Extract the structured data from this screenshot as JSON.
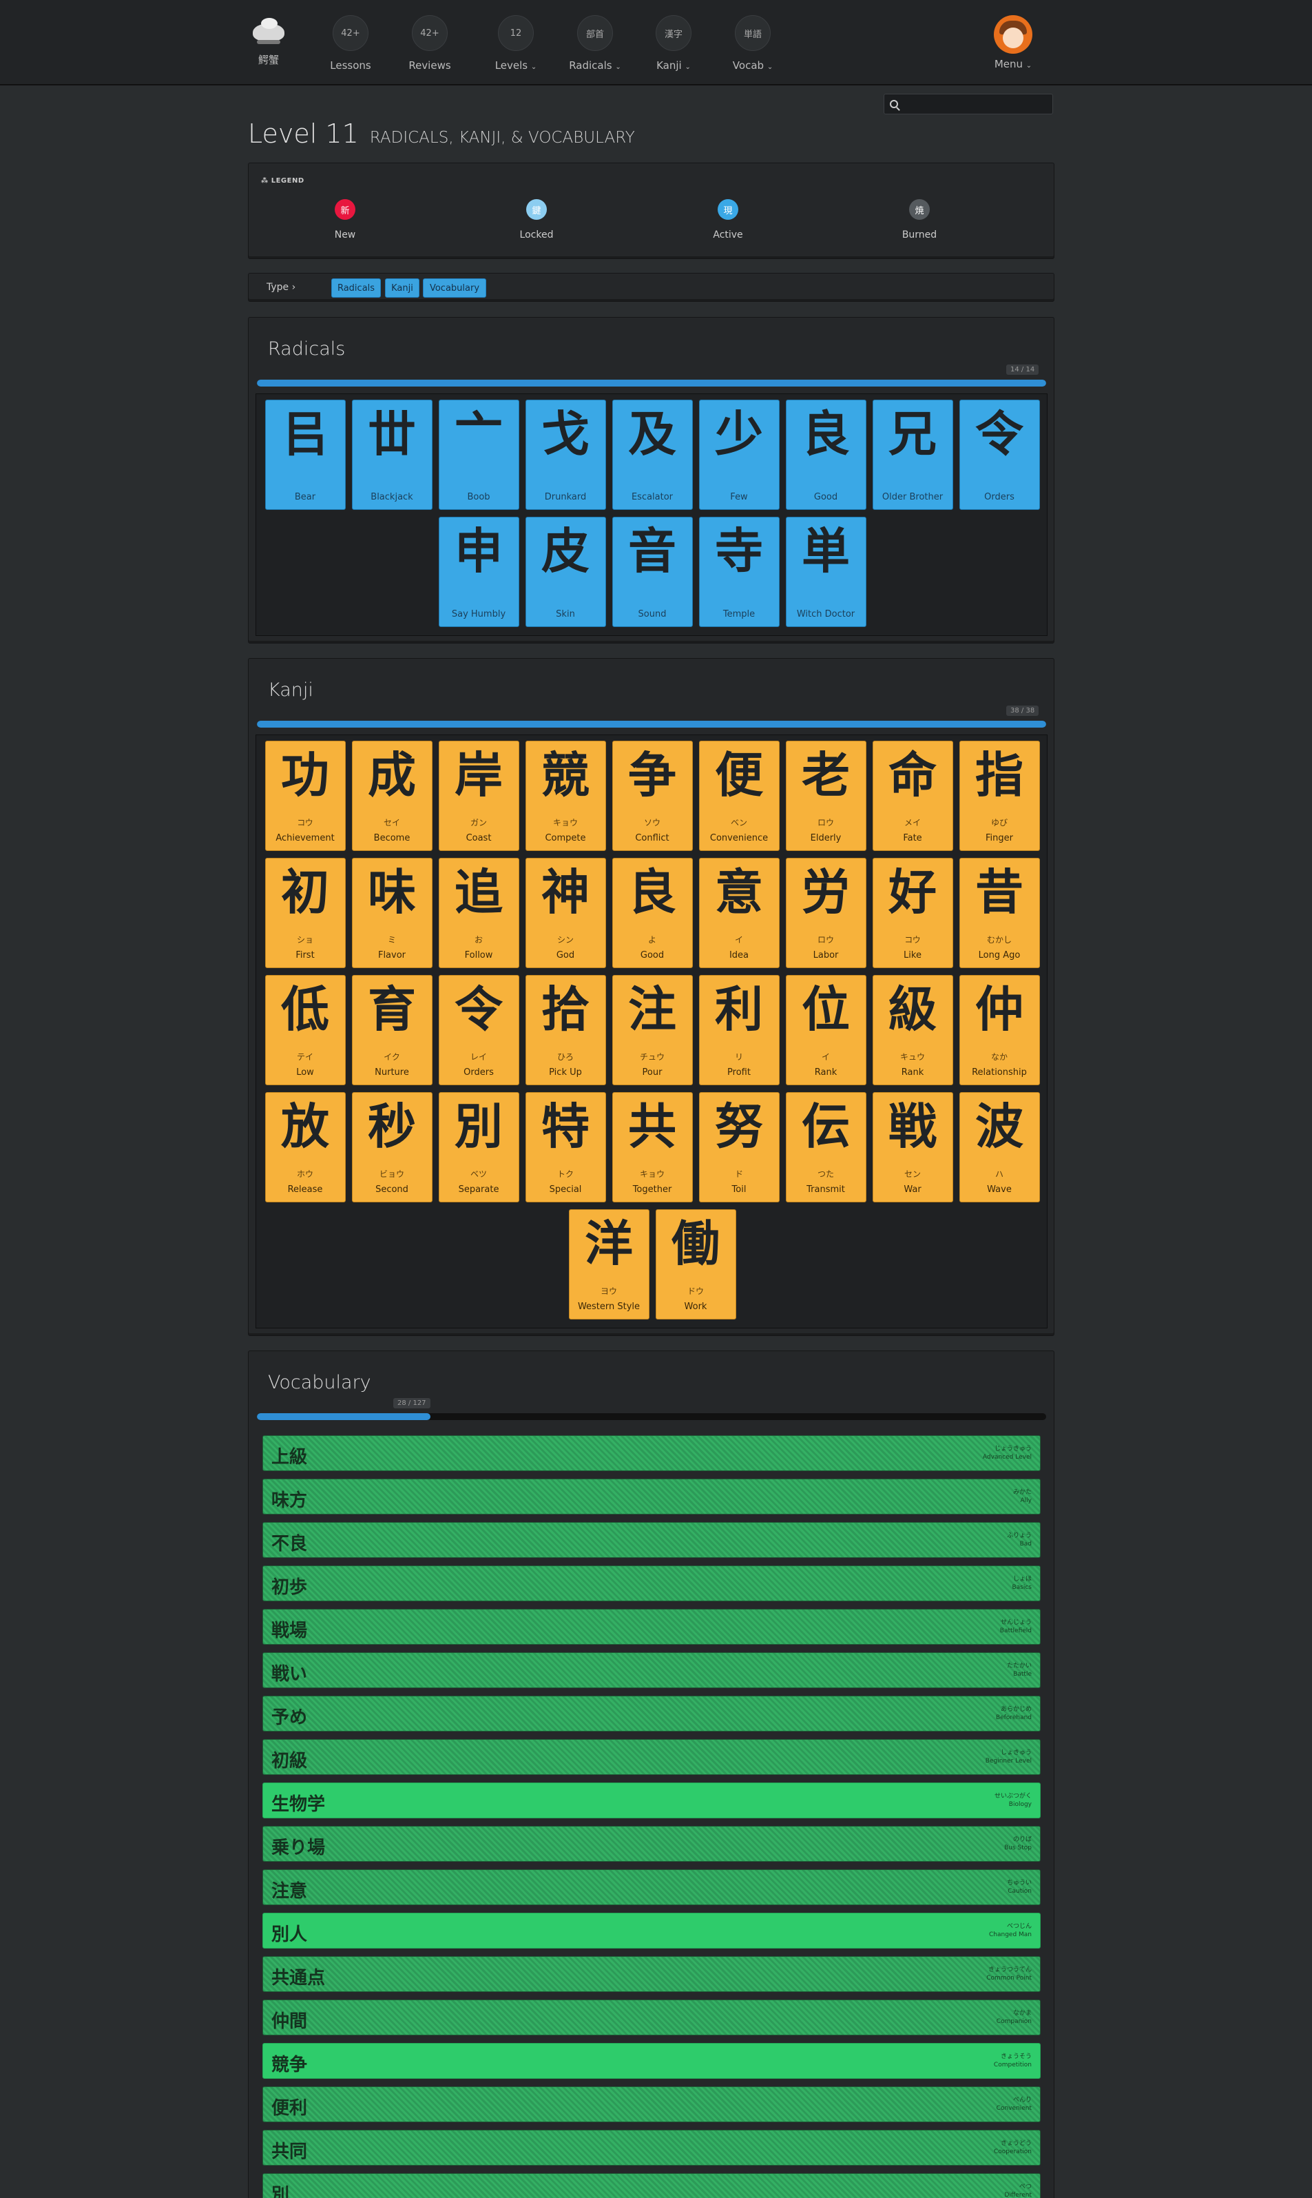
{
  "nav": {
    "logo_label": "鰐蟹",
    "items": [
      {
        "circle": "42+",
        "label": "Lessons"
      },
      {
        "circle": "42+",
        "label": "Reviews"
      },
      {
        "circle": "12",
        "label": "Levels"
      },
      {
        "circle": "部首",
        "label": "Radicals"
      },
      {
        "circle": "漢字",
        "label": "Kanji"
      },
      {
        "circle": "単語",
        "label": "Vocab"
      }
    ],
    "menu_label": "Menu"
  },
  "search": {
    "value": "",
    "placeholder": ""
  },
  "title": {
    "main": "Level 11",
    "sub": "RADICALS, KANJI, & VOCABULARY"
  },
  "legend": {
    "title": "LEGEND",
    "items": [
      {
        "glyph": "新",
        "label": "New",
        "color": "#e8173f"
      },
      {
        "glyph": "鍵",
        "label": "Locked",
        "color": "#8ccdf0"
      },
      {
        "glyph": "現",
        "label": "Active",
        "color": "#3aa8e6"
      },
      {
        "glyph": "焼",
        "label": "Burned",
        "color": "#555a5e"
      }
    ]
  },
  "type_filter": {
    "label": "Type",
    "buttons": [
      "Radicals",
      "Kanji",
      "Vocabulary"
    ]
  },
  "radicals": {
    "title": "Radicals",
    "progress_text": "14 / 14",
    "progress": 1.0,
    "items": [
      {
        "char": "㠯",
        "meaning": "Bear"
      },
      {
        "char": "丗",
        "meaning": "Blackjack"
      },
      {
        "char": "亠",
        "meaning": "Boob"
      },
      {
        "char": "戈",
        "meaning": "Drunkard"
      },
      {
        "char": "及",
        "meaning": "Escalator"
      },
      {
        "char": "少",
        "meaning": "Few"
      },
      {
        "char": "良",
        "meaning": "Good"
      },
      {
        "char": "兄",
        "meaning": "Older Brother"
      },
      {
        "char": "令",
        "meaning": "Orders"
      },
      {
        "char": "申",
        "meaning": "Say Humbly"
      },
      {
        "char": "皮",
        "meaning": "Skin"
      },
      {
        "char": "音",
        "meaning": "Sound"
      },
      {
        "char": "寺",
        "meaning": "Temple"
      },
      {
        "char": "単",
        "meaning": "Witch Doctor"
      }
    ]
  },
  "kanji": {
    "title": "Kanji",
    "progress_text": "38 / 38",
    "progress": 1.0,
    "items": [
      {
        "char": "功",
        "reading": "コウ",
        "meaning": "Achievement"
      },
      {
        "char": "成",
        "reading": "セイ",
        "meaning": "Become"
      },
      {
        "char": "岸",
        "reading": "ガン",
        "meaning": "Coast"
      },
      {
        "char": "競",
        "reading": "キョウ",
        "meaning": "Compete"
      },
      {
        "char": "争",
        "reading": "ソウ",
        "meaning": "Conflict"
      },
      {
        "char": "便",
        "reading": "ベン",
        "meaning": "Convenience"
      },
      {
        "char": "老",
        "reading": "ロウ",
        "meaning": "Elderly"
      },
      {
        "char": "命",
        "reading": "メイ",
        "meaning": "Fate"
      },
      {
        "char": "指",
        "reading": "ゆび",
        "meaning": "Finger"
      },
      {
        "char": "初",
        "reading": "ショ",
        "meaning": "First"
      },
      {
        "char": "味",
        "reading": "ミ",
        "meaning": "Flavor"
      },
      {
        "char": "追",
        "reading": "お",
        "meaning": "Follow"
      },
      {
        "char": "神",
        "reading": "シン",
        "meaning": "God"
      },
      {
        "char": "良",
        "reading": "よ",
        "meaning": "Good"
      },
      {
        "char": "意",
        "reading": "イ",
        "meaning": "Idea"
      },
      {
        "char": "労",
        "reading": "ロウ",
        "meaning": "Labor"
      },
      {
        "char": "好",
        "reading": "コウ",
        "meaning": "Like"
      },
      {
        "char": "昔",
        "reading": "むかし",
        "meaning": "Long Ago"
      },
      {
        "char": "低",
        "reading": "テイ",
        "meaning": "Low"
      },
      {
        "char": "育",
        "reading": "イク",
        "meaning": "Nurture"
      },
      {
        "char": "令",
        "reading": "レイ",
        "meaning": "Orders"
      },
      {
        "char": "拾",
        "reading": "ひろ",
        "meaning": "Pick Up"
      },
      {
        "char": "注",
        "reading": "チュウ",
        "meaning": "Pour"
      },
      {
        "char": "利",
        "reading": "リ",
        "meaning": "Profit"
      },
      {
        "char": "位",
        "reading": "イ",
        "meaning": "Rank"
      },
      {
        "char": "級",
        "reading": "キュウ",
        "meaning": "Rank"
      },
      {
        "char": "仲",
        "reading": "なか",
        "meaning": "Relationship"
      },
      {
        "char": "放",
        "reading": "ホウ",
        "meaning": "Release"
      },
      {
        "char": "秒",
        "reading": "ビョウ",
        "meaning": "Second"
      },
      {
        "char": "別",
        "reading": "ベツ",
        "meaning": "Separate"
      },
      {
        "char": "特",
        "reading": "トク",
        "meaning": "Special"
      },
      {
        "char": "共",
        "reading": "キョウ",
        "meaning": "Together"
      },
      {
        "char": "努",
        "reading": "ド",
        "meaning": "Toil"
      },
      {
        "char": "伝",
        "reading": "つた",
        "meaning": "Transmit"
      },
      {
        "char": "戦",
        "reading": "セン",
        "meaning": "War"
      },
      {
        "char": "波",
        "reading": "ハ",
        "meaning": "Wave"
      },
      {
        "char": "洋",
        "reading": "ヨウ",
        "meaning": "Western Style"
      },
      {
        "char": "働",
        "reading": "ドウ",
        "meaning": "Work"
      }
    ]
  },
  "vocabulary": {
    "title": "Vocabulary",
    "progress_text": "28 / 127",
    "progress": 0.22,
    "items": [
      {
        "char": "上級",
        "reading": "じょうきゅう",
        "meaning": "Advanced Level",
        "bright": false
      },
      {
        "char": "味方",
        "reading": "みかた",
        "meaning": "Ally",
        "bright": false
      },
      {
        "char": "不良",
        "reading": "ふりょう",
        "meaning": "Bad",
        "bright": false
      },
      {
        "char": "初歩",
        "reading": "しょほ",
        "meaning": "Basics",
        "bright": false
      },
      {
        "char": "戦場",
        "reading": "せんじょう",
        "meaning": "Battlefield",
        "bright": false
      },
      {
        "char": "戦い",
        "reading": "たたかい",
        "meaning": "Battle",
        "bright": false
      },
      {
        "char": "予め",
        "reading": "あらかじめ",
        "meaning": "Beforehand",
        "bright": false
      },
      {
        "char": "初級",
        "reading": "しょきゅう",
        "meaning": "Beginner Level",
        "bright": false
      },
      {
        "char": "生物学",
        "reading": "せいぶつがく",
        "meaning": "Biology",
        "bright": true
      },
      {
        "char": "乗り場",
        "reading": "のりば",
        "meaning": "Bus Stop",
        "bright": false
      },
      {
        "char": "注意",
        "reading": "ちゅうい",
        "meaning": "Caution",
        "bright": false
      },
      {
        "char": "別人",
        "reading": "べつじん",
        "meaning": "Changed Man",
        "bright": true
      },
      {
        "char": "共通点",
        "reading": "きょうつうてん",
        "meaning": "Common Point",
        "bright": false
      },
      {
        "char": "仲間",
        "reading": "なかま",
        "meaning": "Companion",
        "bright": false
      },
      {
        "char": "競争",
        "reading": "きょうそう",
        "meaning": "Competition",
        "bright": true
      },
      {
        "char": "便利",
        "reading": "べんり",
        "meaning": "Convenient",
        "bright": false
      },
      {
        "char": "共同",
        "reading": "きょうどう",
        "meaning": "Cooperation",
        "bright": false
      },
      {
        "char": "別",
        "reading": "べつ",
        "meaning": "Different",
        "bright": false
      }
    ]
  }
}
